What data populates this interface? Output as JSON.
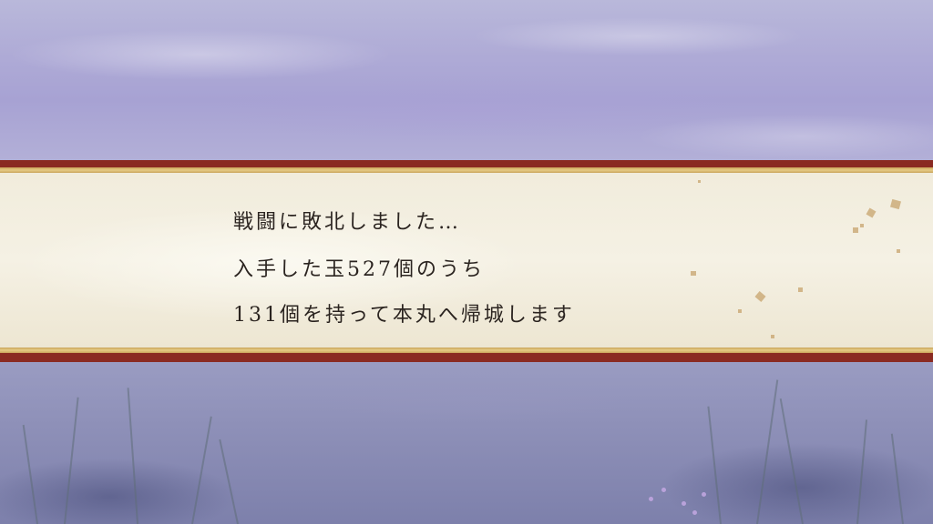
{
  "result_message": {
    "lines": [
      "戦闘に敗北しました…",
      "入手した玉527個のうち",
      "131個を持って本丸へ帰城します"
    ]
  },
  "colors": {
    "banner_border": "#8a2a22",
    "banner_gold": "#c9a35a",
    "paper": "#f1ecdc",
    "text": "#2b2420"
  }
}
